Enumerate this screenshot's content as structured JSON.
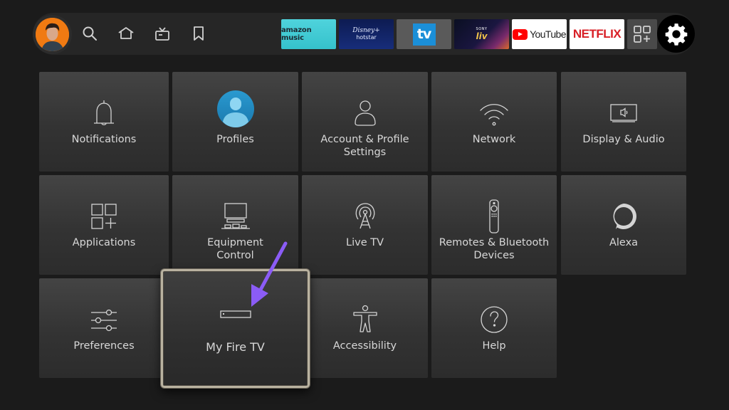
{
  "top_nav": {
    "profile": {
      "name": "profile-avatar"
    },
    "icons": [
      {
        "name": "search-icon",
        "label": "Search"
      },
      {
        "name": "home-icon",
        "label": "Home"
      },
      {
        "name": "live-tv-icon",
        "label": "Live"
      },
      {
        "name": "bookmark-icon",
        "label": "Watchlist"
      }
    ],
    "apps": [
      {
        "id": "amazon-music",
        "label": "amazon music"
      },
      {
        "id": "disney-hotstar",
        "label_top": "Disney+",
        "label_bottom": "hotstar"
      },
      {
        "id": "tv",
        "label": "tv"
      },
      {
        "id": "sony-liv",
        "label_top": "SONY",
        "label_bottom": "liv"
      },
      {
        "id": "youtube",
        "label": "YouTube"
      },
      {
        "id": "netflix",
        "label": "NETFLIX"
      }
    ],
    "all_apps_icon": "app-grid-plus-icon",
    "settings_icon": "gear-icon",
    "colors": {
      "youtube_red": "#ff0000",
      "netflix_red": "#d81f26",
      "amazon_music_teal": "#41cbd4",
      "focus_border": "#b9b2a0",
      "annotation_arrow": "#8b5cf6"
    }
  },
  "settings": {
    "tiles": [
      {
        "id": "notifications",
        "label": "Notifications",
        "icon": "bell-icon"
      },
      {
        "id": "profiles",
        "label": "Profiles",
        "icon": "profile-circle-icon"
      },
      {
        "id": "account",
        "label": "Account & Profile\nSettings",
        "icon": "person-icon"
      },
      {
        "id": "network",
        "label": "Network",
        "icon": "wifi-icon"
      },
      {
        "id": "display-audio",
        "label": "Display & Audio",
        "icon": "tv-speaker-icon"
      },
      {
        "id": "applications",
        "label": "Applications",
        "icon": "apps-grid-icon"
      },
      {
        "id": "equipment",
        "label": "Equipment\nControl",
        "icon": "equipment-icon"
      },
      {
        "id": "live-tv",
        "label": "Live TV",
        "icon": "antenna-icon"
      },
      {
        "id": "remotes",
        "label": "Remotes & Bluetooth\nDevices",
        "icon": "remote-icon"
      },
      {
        "id": "alexa",
        "label": "Alexa",
        "icon": "alexa-icon"
      },
      {
        "id": "preferences",
        "label": "Preferences",
        "icon": "sliders-icon"
      },
      {
        "id": "my-fire-tv",
        "label": "My Fire TV",
        "icon": "fire-tv-stick-icon",
        "focused": true
      },
      {
        "id": "accessibility",
        "label": "Accessibility",
        "icon": "accessibility-icon"
      },
      {
        "id": "help",
        "label": "Help",
        "icon": "help-icon"
      }
    ]
  },
  "annotation": {
    "type": "arrow",
    "points_to": "my-fire-tv"
  }
}
